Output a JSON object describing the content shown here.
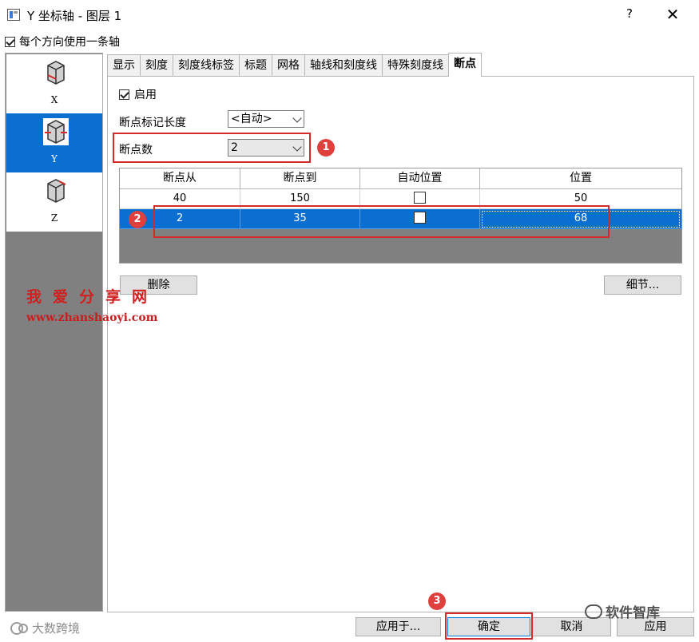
{
  "window": {
    "title": "Y 坐标轴 - 图层 1",
    "help": "?",
    "close": "✕"
  },
  "top_option": {
    "label": "每个方向使用一条轴",
    "checked": true
  },
  "axes": [
    {
      "label": "X",
      "selected": false
    },
    {
      "label": "Y",
      "selected": true
    },
    {
      "label": "Z",
      "selected": false
    }
  ],
  "tabs": [
    "显示",
    "刻度",
    "刻度线标签",
    "标题",
    "网格",
    "轴线和刻度线",
    "特殊刻度线",
    "断点"
  ],
  "active_tab": "断点",
  "breaks": {
    "enable_label": "启用",
    "enabled": true,
    "mark_length_label": "断点标记长度",
    "mark_length_value": "<自动>",
    "count_label": "断点数",
    "count_value": "2"
  },
  "grid": {
    "headers": [
      "断点从",
      "断点到",
      "自动位置",
      "位置"
    ],
    "rows": [
      {
        "from": "40",
        "to": "150",
        "auto": false,
        "position": "50",
        "selected": false
      },
      {
        "from": "2",
        "to": "35",
        "auto": false,
        "position": "68",
        "selected": true
      }
    ]
  },
  "buttons": {
    "delete": "删除",
    "details": "细节...",
    "apply_to": "应用于...",
    "ok": "确定",
    "cancel": "取消",
    "apply": "应用"
  },
  "annotations": {
    "badge1": "1",
    "badge2": "2",
    "badge3": "3"
  },
  "watermarks": {
    "site_cn": "我爱分享网",
    "site_url": "www.zhanshaoyi.com",
    "bottom_left": "大数跨境",
    "bottom_right": "软件智库"
  },
  "colors": {
    "selection": "#0a6fd1",
    "annotation_red": "#d42a2a"
  }
}
